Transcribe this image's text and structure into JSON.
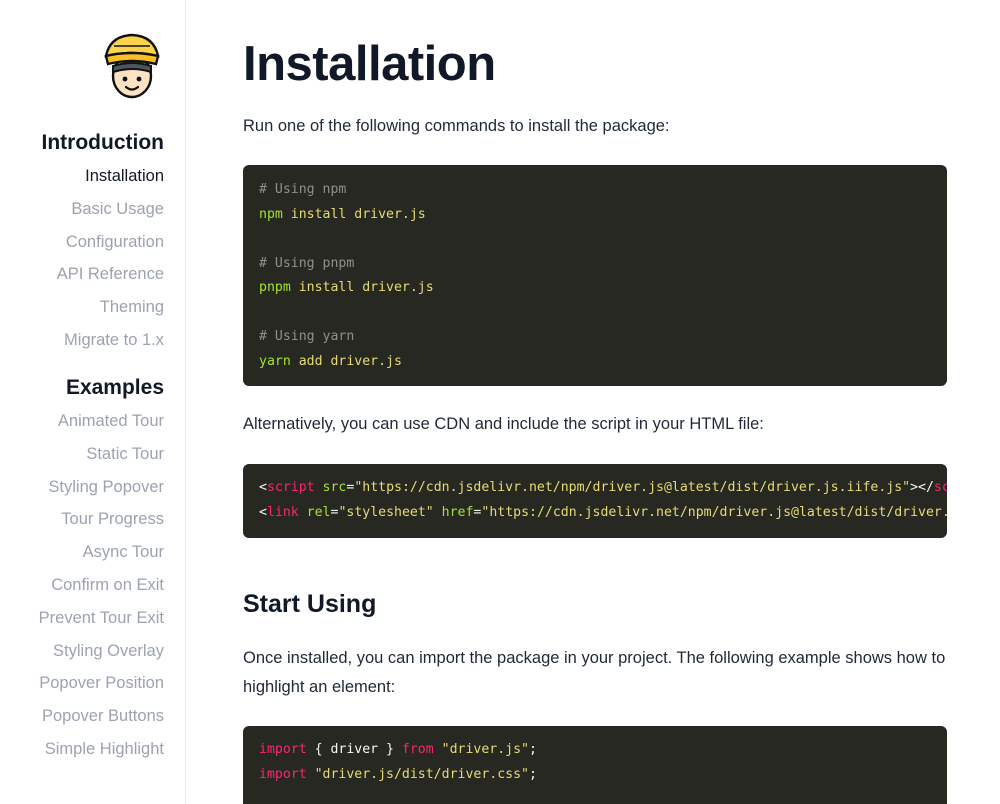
{
  "sidebar": {
    "sections": [
      {
        "heading": "Introduction",
        "items": [
          {
            "label": "Installation",
            "active": true
          },
          {
            "label": "Basic Usage"
          },
          {
            "label": "Configuration"
          },
          {
            "label": "API Reference"
          },
          {
            "label": "Theming"
          },
          {
            "label": "Migrate to 1.x"
          }
        ]
      },
      {
        "heading": "Examples",
        "items": [
          {
            "label": "Animated Tour"
          },
          {
            "label": "Static Tour"
          },
          {
            "label": "Styling Popover"
          },
          {
            "label": "Tour Progress"
          },
          {
            "label": "Async Tour"
          },
          {
            "label": "Confirm on Exit"
          },
          {
            "label": "Prevent Tour Exit"
          },
          {
            "label": "Styling Overlay"
          },
          {
            "label": "Popover Position"
          },
          {
            "label": "Popover Buttons"
          },
          {
            "label": "Simple Highlight"
          }
        ]
      }
    ]
  },
  "main": {
    "title": "Installation",
    "intro": "Run one of the following commands to install the package:",
    "install_code": {
      "npm_comment": "# Using npm",
      "npm_cmd": "npm",
      "npm_args": " install driver.js",
      "pnpm_comment": "# Using pnpm",
      "pnpm_cmd": "pnpm",
      "pnpm_args": " install driver.js",
      "yarn_comment": "# Using yarn",
      "yarn_cmd": "yarn",
      "yarn_args": " add driver.js"
    },
    "cdn_text": "Alternatively, you can use CDN and include the script in your HTML file:",
    "cdn_code": {
      "l1_open": "<",
      "l1_tag": "script",
      "l1_attr": " src",
      "l1_eq": "=",
      "l1_val": "\"https://cdn.jsdelivr.net/npm/driver.js@latest/dist/driver.js.iife.js\"",
      "l1_close": "></",
      "l1_end": "script>",
      "l2_open": "<",
      "l2_tag": "link",
      "l2_attr1": " rel",
      "l2_eq1": "=",
      "l2_val1": "\"stylesheet\"",
      "l2_attr2": " href",
      "l2_eq2": "=",
      "l2_val2": "\"https://cdn.jsdelivr.net/npm/driver.js@latest/dist/driver.css\"",
      "l2_end": "/>"
    },
    "start_heading": "Start Using",
    "start_text": "Once installed, you can import the package in your project. The following example shows how to highlight an element:",
    "import_code": {
      "l1_kw": "import",
      "l1_mid": " { driver } ",
      "l1_from": "from",
      "l1_sp": " ",
      "l1_str": "\"driver.js\"",
      "l1_semi": ";",
      "l2_kw": "import",
      "l2_sp": " ",
      "l2_str": "\"driver.js/dist/driver.css\"",
      "l2_semi": ";"
    }
  },
  "colors": {
    "code_bg": "#272822",
    "comment": "#8f908a",
    "function": "#a6e22e",
    "string": "#e6db74",
    "keyword": "#f92672",
    "nav_muted": "#9ca3af",
    "nav_active": "#111827"
  }
}
